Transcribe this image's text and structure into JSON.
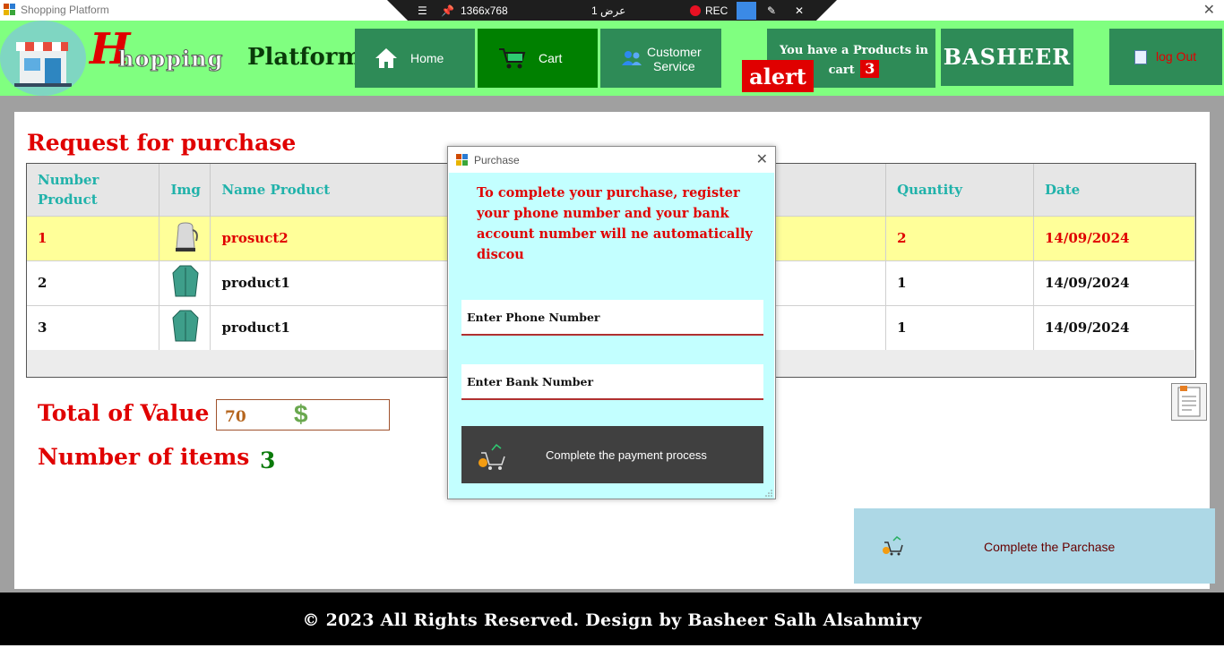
{
  "window": {
    "title": "Shopping Platform",
    "close_glyph": "✕"
  },
  "recorder": {
    "menu_glyph": "☰",
    "resolution": "1366x768",
    "display": "عرض 1",
    "rec": "REC",
    "close_glyph": "✕"
  },
  "header": {
    "brand_h": "H",
    "brand_hopping": "hopping",
    "brand_platform": "Platform",
    "nav": [
      {
        "label": "Home",
        "icon": "home-icon"
      },
      {
        "label": "Cart",
        "icon": "cart-icon"
      },
      {
        "label_line1": "Customer",
        "label_line2": "Service",
        "icon": "users-icon"
      }
    ],
    "cart_alert": {
      "text_line1": "You have a Products in",
      "text_line2": "cart",
      "count": "3"
    },
    "alert_label": "alert",
    "user": "BASHEER",
    "logout": "log Out"
  },
  "main": {
    "title": "Request for purchase",
    "table": {
      "headers": [
        "Number Product",
        "Img",
        "Name Product",
        "Quantity",
        "Date"
      ],
      "rows": [
        {
          "number": "1",
          "img": "kettle",
          "name": "prosuct2",
          "quantity": "2",
          "date": "14/09/2024"
        },
        {
          "number": "2",
          "img": "shirt",
          "name": "product1",
          "quantity": "1",
          "date": "14/09/2024"
        },
        {
          "number": "3",
          "img": "shirt",
          "name": "product1",
          "quantity": "1",
          "date": "14/09/2024"
        }
      ]
    },
    "total_label": "Total of Value",
    "total_value": "70",
    "currency": "$",
    "items_label": "Number of items",
    "items_value": "3",
    "complete_button": "Complete the Parchase"
  },
  "dialog": {
    "title": "Purchase",
    "close_glyph": "✕",
    "message": "To complete your purchase, register your phone number and your bank account number will ne automatically discou",
    "phone_placeholder": "Enter Phone Number",
    "bank_placeholder": "Enter Bank Number",
    "pay_button": "Complete the payment process"
  },
  "footer": {
    "text": "© 2023 All Rights Reserved. Design by Basheer Salh Alsahmiry"
  },
  "colors": {
    "header_bg": "#80ff80",
    "nav_bg": "#2e8b57",
    "active_nav": "#008000",
    "accent_red": "#e00000",
    "dialog_bg": "#c3ffff",
    "teal_header": "#20b2aa"
  }
}
